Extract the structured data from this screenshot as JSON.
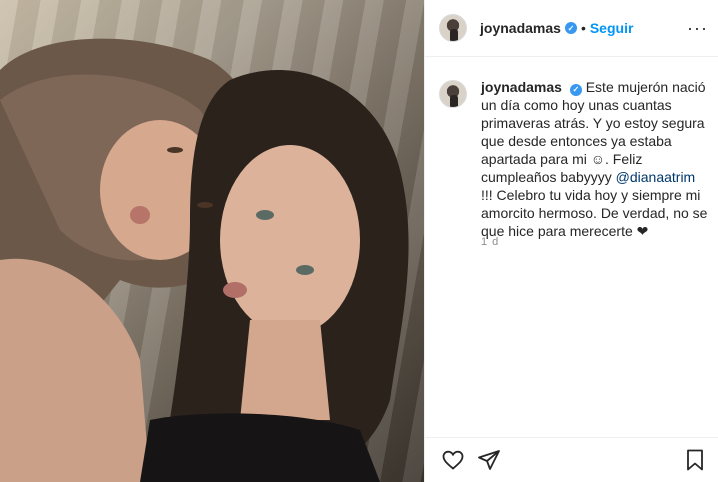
{
  "post": {
    "image": {
      "description_icon": "selfie-photo"
    }
  },
  "header": {
    "username": "joynadamas",
    "verified_icon": "verified-badge-icon",
    "separator": "•",
    "follow_label": "Seguir",
    "more_icon": "ellipsis-icon",
    "more_label": "···"
  },
  "comment": {
    "username": "joynadamas",
    "text_before_mention": "Este mujerón nació un día como hoy unas cuantas primaveras atrás. Y yo estoy segura que desde entonces ya estaba apartada para mi ☺. Feliz cumpleaños babyyyy ",
    "mention": "@dianaatrim",
    "text_after_mention": " !!! Celebro tu vida hoy y siempre mi amorcito hermoso. De verdad, no se que hice para merecerte ❤",
    "time": "1 d"
  },
  "actions": {
    "like_icon": "heart-icon",
    "share_icon": "paper-plane-icon",
    "save_icon": "bookmark-icon"
  },
  "colors": {
    "accent": "#0095f6",
    "verified": "#3897f0",
    "text": "#262626",
    "muted": "#8e8e8e",
    "border": "#efefef"
  }
}
